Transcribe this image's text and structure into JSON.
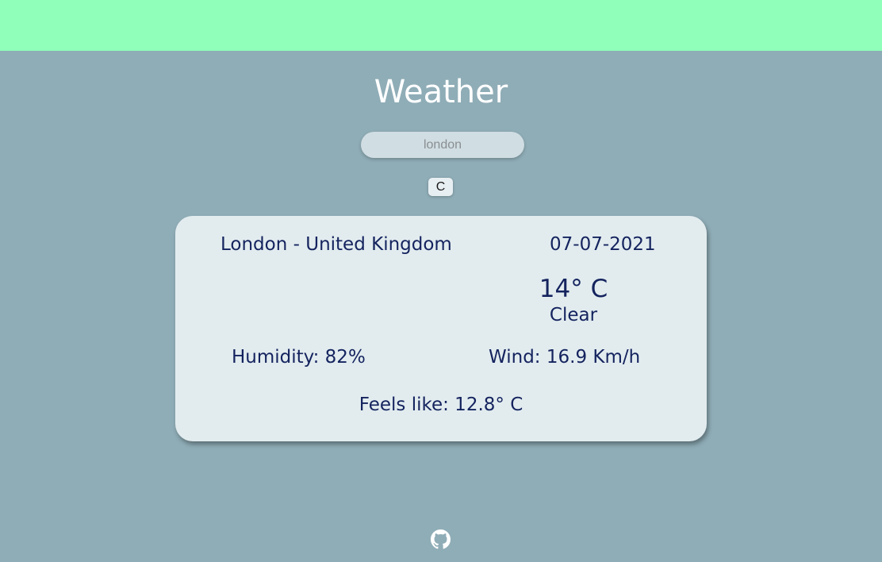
{
  "app": {
    "title": "Weather"
  },
  "search": {
    "placeholder": "london",
    "value": ""
  },
  "unit_toggle": {
    "label": "C"
  },
  "weather": {
    "location": "London - United Kingdom",
    "date": "07-07-2021",
    "icon": "moon-icon",
    "temperature": "14° C",
    "description": "Clear",
    "humidity": "Humidity: 82%",
    "wind": "Wind: 16.9 Km/h",
    "feels_like": "Feels like: 12.8° C"
  },
  "footer": {
    "icon": "github-icon"
  },
  "colors": {
    "header": "#8fffb9",
    "background": "#8fadb7",
    "card": "#e2ecef",
    "text": "#14235e",
    "icon": "#1473d6"
  }
}
